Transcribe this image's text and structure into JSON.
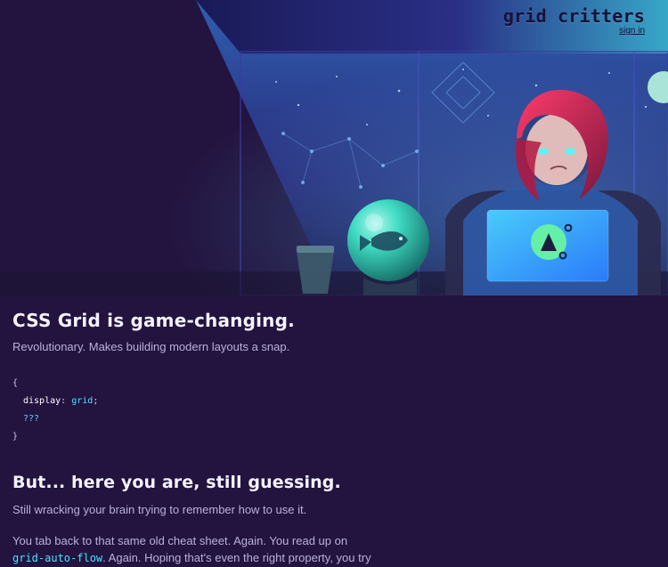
{
  "header": {
    "brand": "grid critters",
    "signin": "sign in"
  },
  "hero": {
    "playButtonIcon": "play-triangle-icon"
  },
  "main": {
    "title1": "CSS Grid is game-changing.",
    "subtitle1": "Revolutionary. Makes building modern layouts a snap.",
    "code": {
      "open": "{",
      "prop": "display",
      "colon": ":",
      "value": "grid",
      "semi": ";",
      "qq": "???",
      "close": "}"
    },
    "title2": "But... here you are, still guessing.",
    "p1": "Still wracking your brain trying to remember how to use it.",
    "p2_before": "You tab back to that same old cheat sheet. Again. You read up on",
    "p2_code": "grid-auto-flow",
    "p2_after": ". Again. Hoping that's even the right property, you try"
  },
  "colors": {
    "background": "#23133f",
    "accent": "#36c6ff"
  }
}
